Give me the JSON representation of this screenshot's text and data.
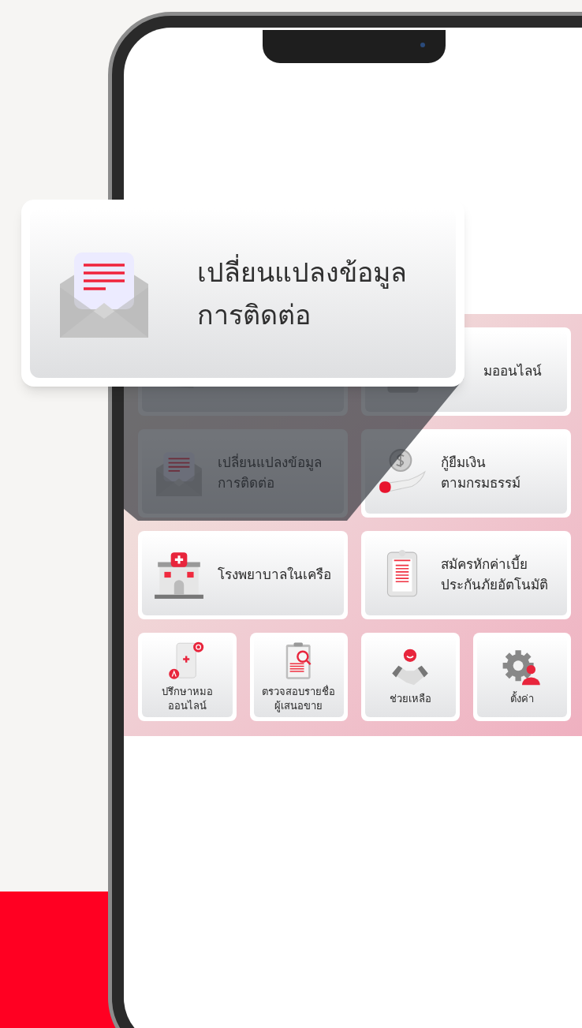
{
  "callout": {
    "kind": "envelope",
    "label": "เปลี่ยนแปลงข้อมูล\nการติดต่อ"
  },
  "large_items": [
    {
      "kind": "partial"
    },
    {
      "kind": "document",
      "label": "มออนไลน์"
    },
    {
      "kind": "envelope",
      "label": "เปลี่ยนแปลงข้อมูล\nการติดต่อ"
    },
    {
      "kind": "coin-hand",
      "label": "กู้ยืมเงิน\nตามกรมธรรม์"
    },
    {
      "kind": "hospital",
      "label": "โรงพยาบาลในเครือ"
    },
    {
      "kind": "receipt",
      "label": "สมัครหักค่าเบี้ย\nประกันภัยอัตโนมัติ"
    }
  ],
  "small_items": [
    {
      "kind": "phone-qa",
      "label": "ปรึกษาหมอ\nออนไลน์"
    },
    {
      "kind": "clipboard-search",
      "label": "ตรวจสอบรายชื่อ\nผู้เสนอขาย"
    },
    {
      "kind": "handshake",
      "label": "ช่วยเหลือ"
    },
    {
      "kind": "gear-person",
      "label": "ตั้งค่า"
    }
  ]
}
